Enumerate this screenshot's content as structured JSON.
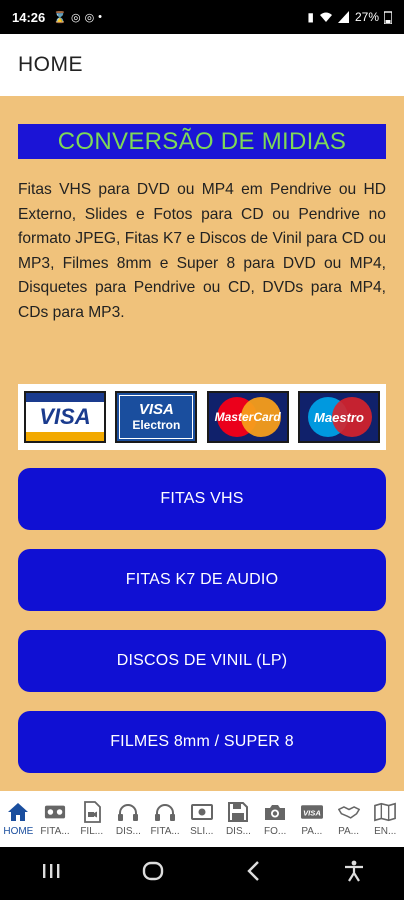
{
  "status_bar": {
    "time": "14:26",
    "battery": "27%"
  },
  "app_bar": {
    "title": "HOME"
  },
  "banner": {
    "text": "CONVERSÃO DE MIDIAS"
  },
  "description": "Fitas VHS para DVD ou MP4 em Pendrive ou HD Externo, Slides e Fotos para CD ou Pendrive no formato JPEG, Fitas K7 e Discos de Vinil para CD ou MP3, Filmes 8mm e Super 8 para DVD ou MP4, Disquetes para Pendrive ou CD, DVDs para MP4, CDs para MP3.",
  "payment_cards": {
    "visa": "VISA",
    "electron_top": "VISA",
    "electron_bottom": "Electron",
    "mastercard": "MasterCard",
    "maestro": "Maestro"
  },
  "menu_buttons": [
    {
      "label": "FITAS VHS"
    },
    {
      "label": "FITAS K7 DE AUDIO"
    },
    {
      "label": "DISCOS DE VINIL (LP)"
    },
    {
      "label": "FILMES 8mm / SUPER 8"
    }
  ],
  "bottom_nav": [
    {
      "label": "HOME",
      "icon": "home-icon"
    },
    {
      "label": "FITA...",
      "icon": "cassette-icon"
    },
    {
      "label": "FIL...",
      "icon": "film-file-icon"
    },
    {
      "label": "DIS...",
      "icon": "headphones-icon"
    },
    {
      "label": "FITA...",
      "icon": "headphones-icon"
    },
    {
      "label": "SLI...",
      "icon": "slides-icon"
    },
    {
      "label": "DIS...",
      "icon": "floppy-disk-icon"
    },
    {
      "label": "FO...",
      "icon": "camera-icon"
    },
    {
      "label": "PA...",
      "icon": "visa-card-icon"
    },
    {
      "label": "PA...",
      "icon": "handshake-icon"
    },
    {
      "label": "EN...",
      "icon": "map-icon"
    }
  ],
  "colors": {
    "accent": "#1010D3",
    "background": "#F0C27B",
    "banner_text": "#7ED957",
    "active_nav": "#1A4E9E"
  }
}
